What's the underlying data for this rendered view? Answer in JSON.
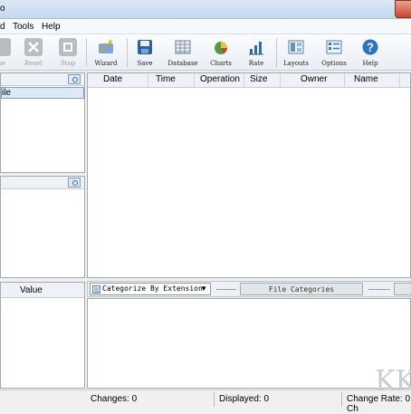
{
  "titlebar": {
    "title": "o"
  },
  "menu": {
    "items": [
      "d",
      "Tools",
      "Help"
    ]
  },
  "toolbar": {
    "buttons": [
      {
        "label": "se",
        "icon": "close-icon",
        "enabled": false
      },
      {
        "label": "Reset",
        "icon": "reset-icon",
        "enabled": false
      },
      {
        "label": "Stop",
        "icon": "stop-icon",
        "enabled": false
      },
      {
        "label": "Wizard",
        "icon": "wizard-icon",
        "enabled": true
      },
      {
        "label": "Save",
        "icon": "save-icon",
        "enabled": true
      },
      {
        "label": "Database",
        "icon": "database-icon",
        "enabled": true
      },
      {
        "label": "Charts",
        "icon": "charts-icon",
        "enabled": true
      },
      {
        "label": "Rate",
        "icon": "rate-icon",
        "enabled": true
      },
      {
        "label": "Layouts",
        "icon": "layouts-icon",
        "enabled": true
      },
      {
        "label": "Options",
        "icon": "options-icon",
        "enabled": true
      },
      {
        "label": "Help",
        "icon": "help-icon",
        "enabled": true
      }
    ]
  },
  "left_top_panel": {
    "selected_item": "ile"
  },
  "left_bottom_panel": {
    "value_header": "Value"
  },
  "file_table": {
    "columns": [
      "Date",
      "Time",
      "Operation",
      "Size",
      "Owner",
      "Name"
    ]
  },
  "categories": {
    "dropdown_value": "Categorize By Extension",
    "button_label": "File Categories"
  },
  "status": {
    "changes": "Changes: 0",
    "displayed": "Displayed: 0",
    "change_rate": "Change Rate: 0 Ch"
  },
  "watermark": "KK"
}
